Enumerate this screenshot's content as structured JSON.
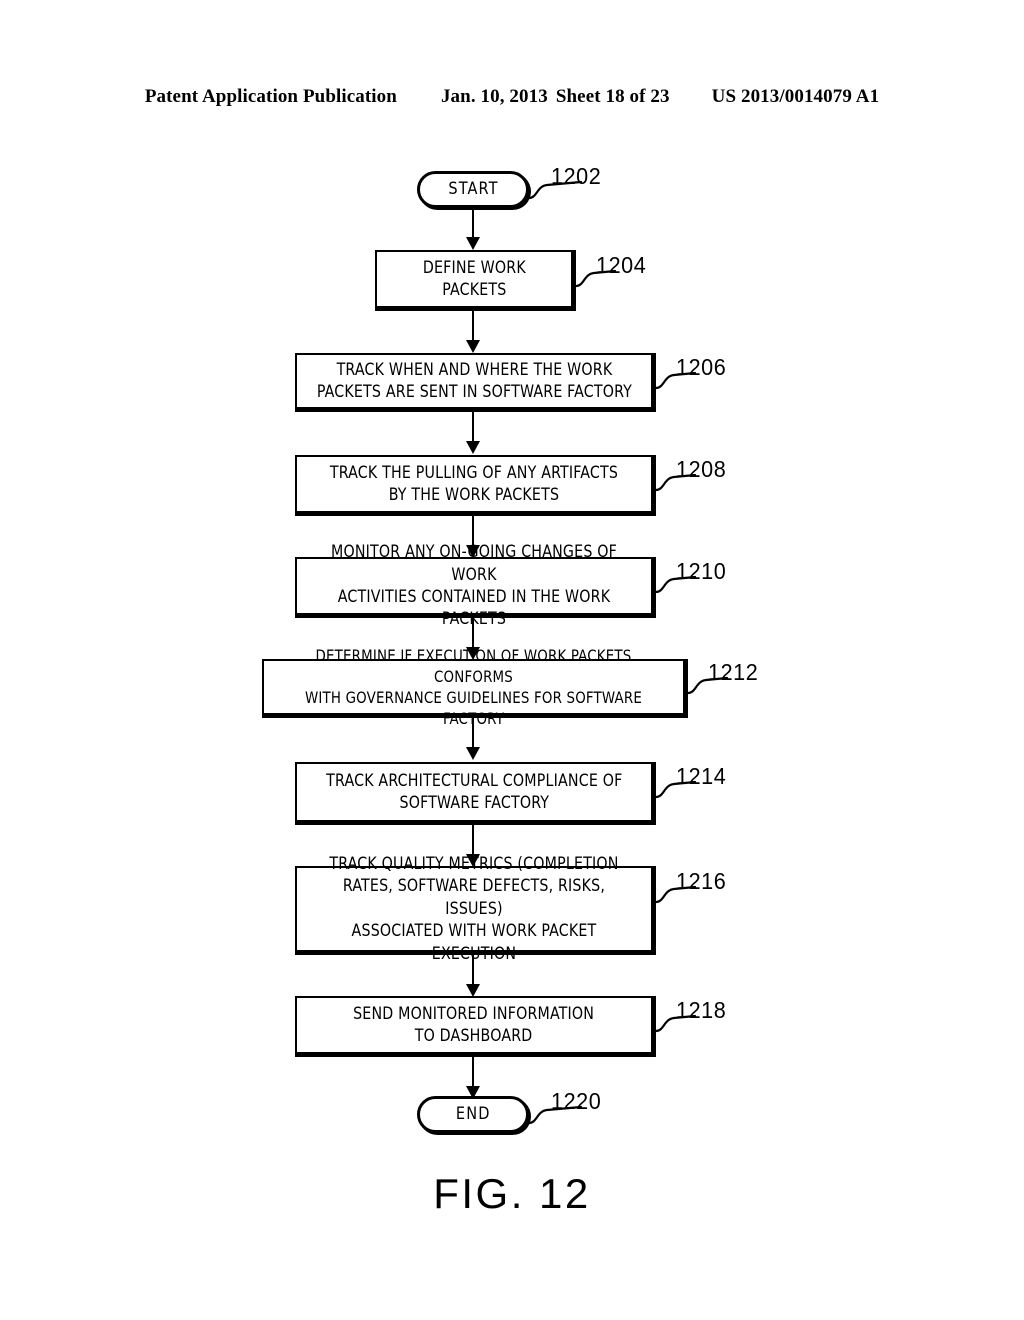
{
  "header": {
    "publication": "Patent Application Publication",
    "date": "Jan. 10, 2013",
    "sheet": "Sheet 18 of 23",
    "patent_number": "US 2013/0014079 A1"
  },
  "figure": {
    "caption": "FIG. 12"
  },
  "flowchart": {
    "type": "flowchart",
    "orientation": "vertical",
    "nodes": [
      {
        "id": "start",
        "shape": "terminator",
        "label": "START",
        "ref": "1202"
      },
      {
        "id": "define-work-packets",
        "shape": "process",
        "label": "DEFINE WORK\nPACKETS",
        "ref": "1204"
      },
      {
        "id": "track-when-where-sent",
        "shape": "process",
        "label": "TRACK WHEN AND WHERE THE WORK\nPACKETS ARE SENT IN SOFTWARE FACTORY",
        "ref": "1206"
      },
      {
        "id": "track-pulling-artifacts",
        "shape": "process",
        "label": "TRACK THE PULLING OF ANY ARTIFACTS\nBY THE WORK PACKETS",
        "ref": "1208"
      },
      {
        "id": "monitor-ongoing-changes",
        "shape": "process",
        "label": "MONITOR ANY ON-GOING CHANGES OF WORK\nACTIVITIES CONTAINED IN THE WORK PACKETS",
        "ref": "1210"
      },
      {
        "id": "determine-governance-conformance",
        "shape": "process",
        "label": "DETERMINE IF EXECUTION OF WORK PACKETS CONFORMS\nWITH GOVERNANCE GUIDELINES FOR SOFTWARE FACTORY",
        "ref": "1212"
      },
      {
        "id": "track-architectural-compliance",
        "shape": "process",
        "label": "TRACK ARCHITECTURAL COMPLIANCE OF\nSOFTWARE FACTORY",
        "ref": "1214"
      },
      {
        "id": "track-quality-metrics",
        "shape": "process",
        "label": "TRACK QUALITY METRICS (COMPLETION\nRATES, SOFTWARE DEFECTS, RISKS, ISSUES)\nASSOCIATED WITH WORK PACKET EXECUTION",
        "ref": "1216"
      },
      {
        "id": "send-monitored-information",
        "shape": "process",
        "label": "SEND MONITORED INFORMATION\nTO DASHBOARD",
        "ref": "1218"
      },
      {
        "id": "end",
        "shape": "terminator",
        "label": "END",
        "ref": "1220"
      }
    ]
  },
  "colors": {
    "ink": "#000000",
    "paper": "#ffffff"
  }
}
